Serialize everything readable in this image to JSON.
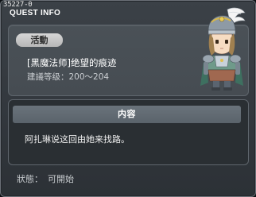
{
  "window": {
    "quest_id": "35227-0",
    "title": "QUEST INFO"
  },
  "quest": {
    "type_badge": "活動",
    "name": "[黑魔法师]绝望的痕迹",
    "level_label": "建議等级：",
    "level_range": "200～204"
  },
  "content": {
    "header": "内容",
    "text": "阿扎琳说这回由她来找路。"
  },
  "status": {
    "label": "狀態：",
    "value": "可開始"
  },
  "colors": {
    "window_bg": "#373d43",
    "info_panel_bg": "#484f55",
    "content_panel_bg": "#2a2f33",
    "content_header_bg": "#5f6870",
    "badge_bg": "#c8c8c8",
    "text_primary": "#ffffff",
    "text_secondary": "#c9cdd1"
  },
  "icons": {
    "portrait": "npc-knight-portrait"
  }
}
